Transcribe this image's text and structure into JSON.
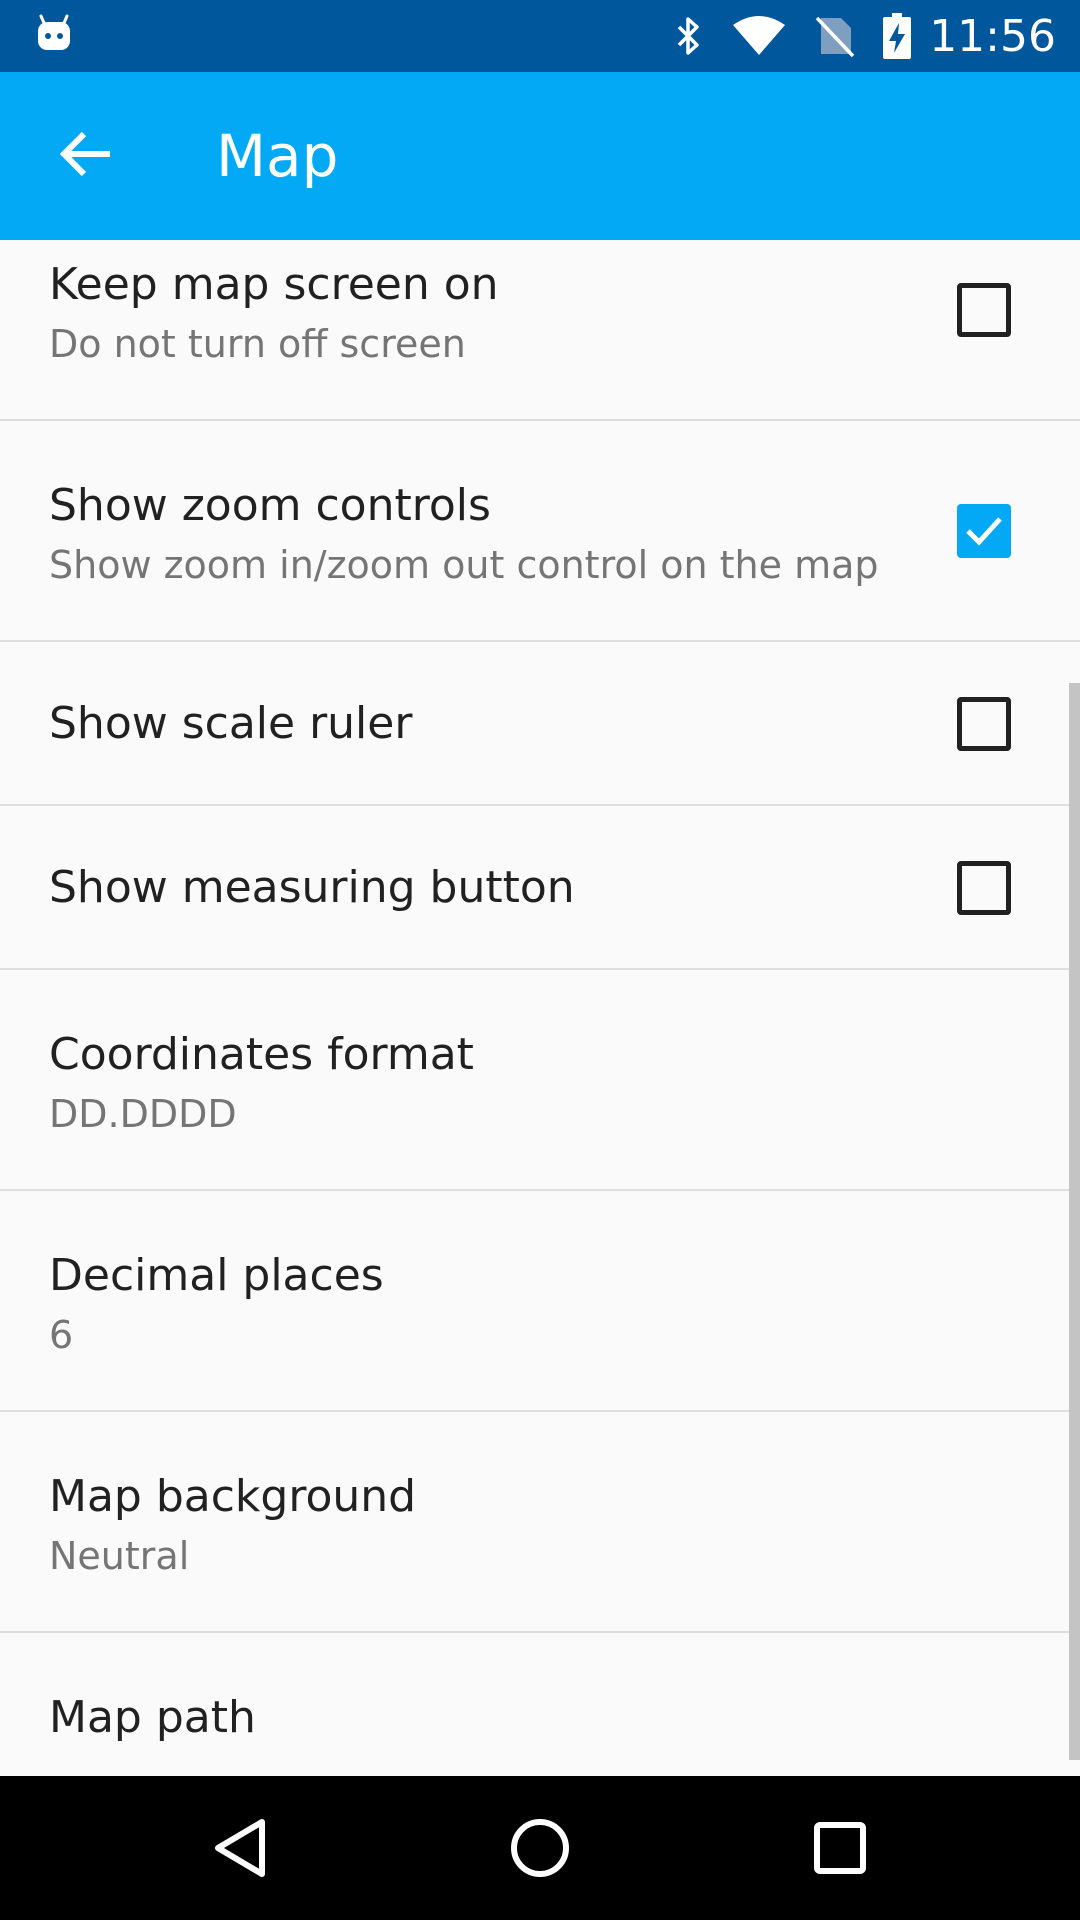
{
  "status_bar": {
    "time": "11:56",
    "icons": [
      "android-robot-icon",
      "bluetooth-icon",
      "wifi-icon",
      "no-sim-icon",
      "battery-charging-icon"
    ]
  },
  "app_bar": {
    "title": "Map",
    "back_icon": "arrow-back-icon"
  },
  "preferences": [
    {
      "title": "Keep map screen on",
      "summary": "Do not turn off screen",
      "checked": false
    },
    {
      "title": "Show zoom controls",
      "summary": "Show zoom in/zoom out control on the map",
      "checked": true
    },
    {
      "title": "Show scale ruler",
      "checked": false
    },
    {
      "title": "Show measuring button",
      "checked": false
    },
    {
      "title": "Coordinates format",
      "summary": "DD.DDDD"
    },
    {
      "title": "Decimal places",
      "summary": "6"
    },
    {
      "title": "Map background",
      "summary": "Neutral"
    },
    {
      "title": "Map path"
    }
  ],
  "colors": {
    "status_bar": "#01579b",
    "app_bar": "#03a9f4",
    "checkbox_checked": "#03a9f4",
    "background": "#fafafa",
    "navigation_bar": "#000000"
  },
  "nav_bar": {
    "icons": [
      "back-triangle-icon",
      "home-circle-icon",
      "recents-square-icon"
    ]
  }
}
